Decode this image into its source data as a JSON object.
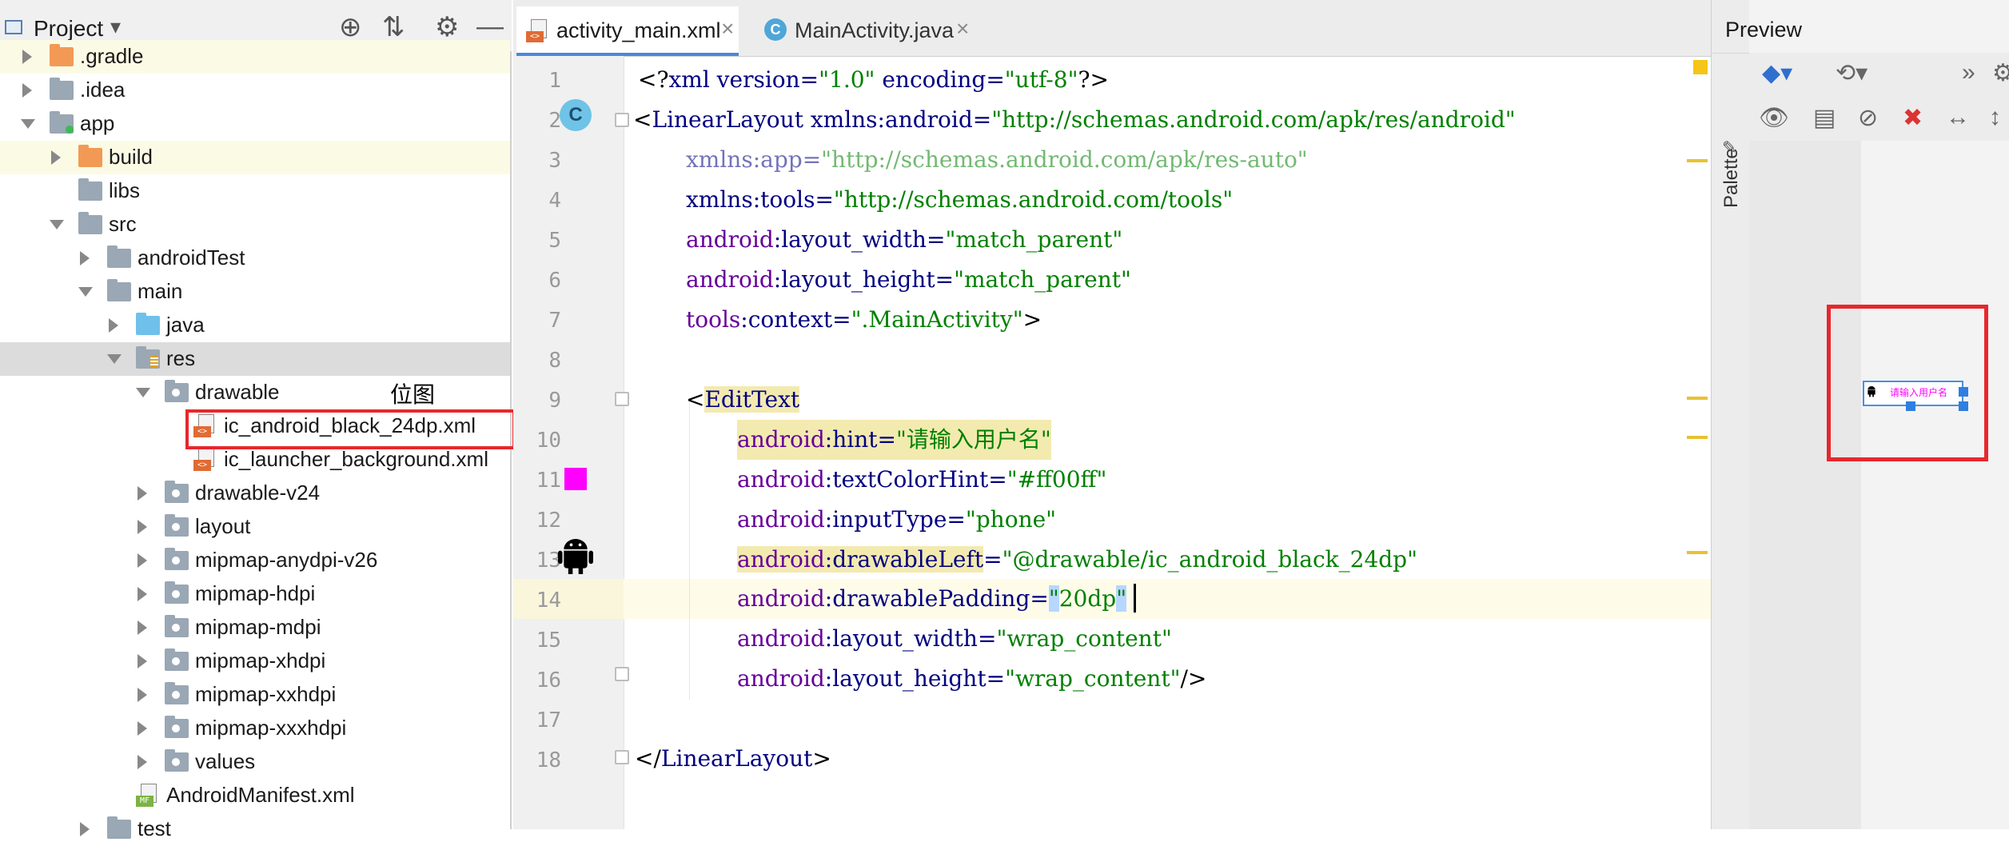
{
  "project_panel": {
    "title": "Project",
    "dropdown": "▾",
    "tools": [
      "⊕",
      "⇅",
      "⚙",
      "—"
    ],
    "tree": [
      {
        "label": ".gradle",
        "indent": 1,
        "arrow": "right",
        "icon": "folder-orange",
        "highlight": "yellow"
      },
      {
        "label": ".idea",
        "indent": 1,
        "arrow": "right",
        "icon": "folder-gray"
      },
      {
        "label": "app",
        "indent": 1,
        "arrow": "down",
        "icon": "folder-module"
      },
      {
        "label": "build",
        "indent": 2,
        "arrow": "right",
        "icon": "folder-orange",
        "highlight": "yellow"
      },
      {
        "label": "libs",
        "indent": 2,
        "arrow": "",
        "icon": "folder-gray"
      },
      {
        "label": "src",
        "indent": 2,
        "arrow": "down",
        "icon": "folder-gray"
      },
      {
        "label": "androidTest",
        "indent": 3,
        "arrow": "right",
        "icon": "folder-gray"
      },
      {
        "label": "main",
        "indent": 3,
        "arrow": "down",
        "icon": "folder-gray"
      },
      {
        "label": "java",
        "indent": 4,
        "arrow": "right",
        "icon": "folder-blue"
      },
      {
        "label": "res",
        "indent": 4,
        "arrow": "down",
        "icon": "folder-res",
        "highlight": "gray"
      },
      {
        "label": "drawable",
        "indent": 5,
        "arrow": "down",
        "icon": "folder-package"
      },
      {
        "label": "ic_android_black_24dp.xml",
        "indent": 6,
        "arrow": "",
        "icon": "xml-file"
      },
      {
        "label": "ic_launcher_background.xml",
        "indent": 6,
        "arrow": "",
        "icon": "xml-file"
      },
      {
        "label": "drawable-v24",
        "indent": 5,
        "arrow": "right",
        "icon": "folder-package"
      },
      {
        "label": "layout",
        "indent": 5,
        "arrow": "right",
        "icon": "folder-package"
      },
      {
        "label": "mipmap-anydpi-v26",
        "indent": 5,
        "arrow": "right",
        "icon": "folder-package"
      },
      {
        "label": "mipmap-hdpi",
        "indent": 5,
        "arrow": "right",
        "icon": "folder-package"
      },
      {
        "label": "mipmap-mdpi",
        "indent": 5,
        "arrow": "right",
        "icon": "folder-package"
      },
      {
        "label": "mipmap-xhdpi",
        "indent": 5,
        "arrow": "right",
        "icon": "folder-package"
      },
      {
        "label": "mipmap-xxhdpi",
        "indent": 5,
        "arrow": "right",
        "icon": "folder-package"
      },
      {
        "label": "mipmap-xxxhdpi",
        "indent": 5,
        "arrow": "right",
        "icon": "folder-package"
      },
      {
        "label": "values",
        "indent": 5,
        "arrow": "right",
        "icon": "folder-package"
      },
      {
        "label": "AndroidManifest.xml",
        "indent": 4,
        "arrow": "",
        "icon": "manifest-file"
      },
      {
        "label": "test",
        "indent": 3,
        "arrow": "right",
        "icon": "folder-gray"
      }
    ],
    "annotation_label": "位图"
  },
  "editor": {
    "tabs": [
      {
        "label": "activity_main.xml",
        "icon": "xml-file",
        "active": true,
        "close": "×"
      },
      {
        "label": "MainActivity.java",
        "icon": "class-c",
        "active": false,
        "close": "×"
      }
    ],
    "line_numbers": [
      "1",
      "2",
      "3",
      "4",
      "5",
      "6",
      "7",
      "8",
      "9",
      "10",
      "11",
      "12",
      "13",
      "14",
      "15",
      "16",
      "17",
      "18"
    ],
    "current_line": "14",
    "gutter_c_glyph": "C",
    "code": {
      "l1": {
        "a": "<?",
        "b": "xml version=",
        "c": "\"1.0\"",
        "d": " encoding=",
        "e": "\"utf-8\"",
        "f": "?>"
      },
      "l2": {
        "a": "<",
        "b": "LinearLayout",
        "c": " xmlns:",
        "d": "android",
        "e": "=",
        "f": "\"http://schemas.android.com/apk/res/android\""
      },
      "l3": {
        "a": "xmlns:",
        "b": "app",
        "c": "=",
        "d": "\"http://schemas.android.com/apk/res-auto\""
      },
      "l4": {
        "a": "xmlns:",
        "b": "tools",
        "c": "=",
        "d": "\"http://schemas.android.com/tools\""
      },
      "l5": {
        "a": "android",
        "b": ":layout_width",
        "c": "=",
        "d": "\"match_parent\""
      },
      "l6": {
        "a": "android",
        "b": ":layout_height",
        "c": "=",
        "d": "\"match_parent\""
      },
      "l7": {
        "a": "tools",
        "b": ":context",
        "c": "=",
        "d": "\".MainActivity\"",
        "e": ">"
      },
      "l9": {
        "a": "<",
        "b": "EditText"
      },
      "l10": {
        "a": "android",
        "b": ":hint",
        "c": "=",
        "d": "\"请输入用户名\""
      },
      "l11": {
        "a": "android",
        "b": ":textColorHint",
        "c": "=",
        "d": "\"#ff00ff\""
      },
      "l12": {
        "a": "android",
        "b": ":inputType",
        "c": "=",
        "d": "\"phone\""
      },
      "l13": {
        "a": "android",
        "b": ":drawableLeft",
        "c": "=",
        "d": "\"@drawable/ic_android_black_24dp\""
      },
      "l14": {
        "a": "android",
        "b": ":drawablePadding",
        "c": "=",
        "d": "\"",
        "e": "20dp",
        "f": "\""
      },
      "l15": {
        "a": "android",
        "b": ":layout_width",
        "c": "=",
        "d": "\"wrap_content\""
      },
      "l16": {
        "a": "android",
        "b": ":layout_height",
        "c": "=",
        "d": "\"wrap_content\"",
        "e": "/>"
      },
      "l18": {
        "a": "</",
        "b": "LinearLayout",
        "c": ">"
      }
    }
  },
  "preview_panel": {
    "title": "Preview",
    "palette_label": "Palette",
    "toolbar_row1": [
      "◆▾",
      "⟲▾",
      "»",
      "⚙"
    ],
    "toolbar_row2": [
      "👁",
      "▤",
      "⊘",
      "✖",
      "↔",
      "↕"
    ],
    "edittext_hint": "请输入用户名",
    "hint_color": "#ff00ff"
  },
  "colors": {
    "annotation_red": "#e8272c",
    "tab_active_underline": "#4a88d8",
    "xml_tag": "#000080",
    "xml_attr_ns": "#660099",
    "xml_value": "#008000"
  }
}
